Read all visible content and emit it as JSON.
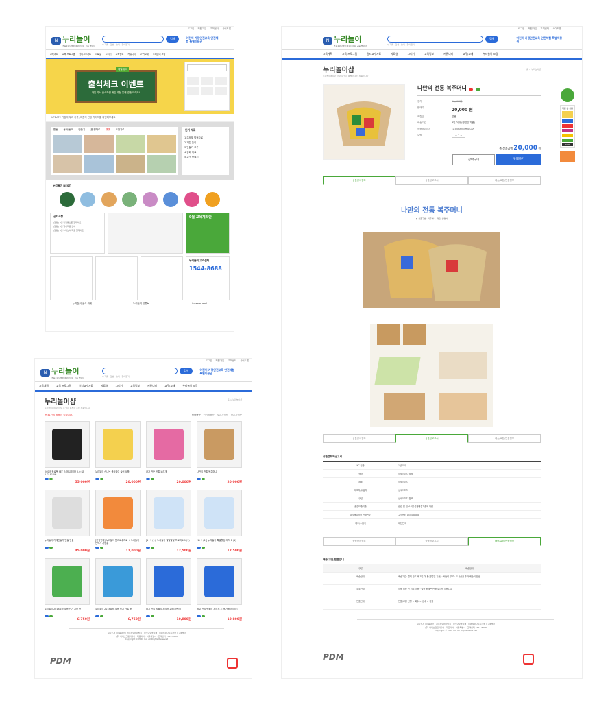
{
  "site": {
    "logo": "누리놀이",
    "logo_sub": "초등1학년부터 6학년까지 교육 놀이터",
    "search_btn": "검색",
    "keywords": "Q 가을 · 감성 · 놀이 · 종이접기",
    "promo": "어린이 가정안전교육 안전체험 특별이용권",
    "menu": [
      "교육계획",
      "교육 프로그램",
      "원리교수자료",
      "자료실",
      "그리기",
      "교육정보",
      "커뮤니티",
      "교구/교재",
      "누리놀이 코딩"
    ],
    "util": [
      "로그인",
      "회원가입",
      "고객센터",
      "사이트맵"
    ]
  },
  "home": {
    "banner_tag": "매일체크",
    "banner_title": "출석체크 이벤트",
    "banner_sub": "매일 가서 출석하면 매일 추첨 통해 경품 드려요!",
    "ticker": "UPDATE 가정의 우리 가족, 여름의 건강 가이드를 확인해보세요",
    "tabs": [
      "활동",
      "동화/동요",
      "만들기",
      "표 정자료",
      "교구",
      "추천자료"
    ],
    "rank_title": "인기 자료",
    "ranks": [
      "1 주제별 활동자료",
      "2 계절 놀이",
      "3 만들기 교구",
      "4 동화 자료",
      "5 교구 만들기"
    ],
    "best_title": "누리놀이 BEST",
    "notice_title": "공지사항",
    "notices": [
      "[알림] 9월 가정통신문 업데이트",
      "[알림] 9월 행사자료 안내",
      "[알림] 9월 누리놀이 자료 업데이트"
    ],
    "plan_title": "9월 교육계획안",
    "cs_title": "누리놀이 고객센터",
    "cs_tel": "1544-8688",
    "bottom": [
      "누리놀이 공식 카페",
      "누리놀이 유튜브",
      "i-Scream mall"
    ]
  },
  "shop": {
    "title": "누리놀이샵",
    "desc": "누리놀이에서만 만날 수 있는 특별한 추천 상품입니다",
    "crumb": "홈 > 누리놀이샵",
    "count": "총 41건의 상품이 있습니다.",
    "sorts": [
      "신상품순",
      "인기상품순",
      "낮은가격순",
      "높은가격순"
    ],
    "products": [
      {
        "name": "[MS]호응로봇 SET 스마트데이터 2.0 SE (LG19109)",
        "old": "",
        "price": "55,000원",
        "color": "#222"
      },
      {
        "name": "누리놀이 신나는 색상놀이 놀이 상품",
        "old": "",
        "price": "20,000원",
        "color": "#f4d04e"
      },
      {
        "name": "내가 만든 신통 노리개",
        "old": "",
        "price": "20,000원",
        "color": "#e56aa3"
      },
      {
        "name": "나만의 전통 복주머니",
        "old": "",
        "price": "20,000원",
        "color": "#c99a62"
      },
      {
        "name": "누리놀이 기계만들기 만들 만들",
        "old": "",
        "price": "45,000원",
        "color": "#ddd"
      },
      {
        "name": "[한정판매] 누리놀이 원리교수자료 + 누리놀이 신학기 가정통",
        "old": "",
        "price": "11,000원",
        "color": "#f28a3c"
      },
      {
        "name": "[1+1 (1)] 누리놀이 발달발달 프로젝트 1 (1)",
        "old": "",
        "price": "12,500원",
        "color": "#cfe3f7"
      },
      {
        "name": "[1+1 (1)] 누리놀이 특별활동 제작 1 (1)",
        "old": "",
        "price": "12,500원",
        "color": "#cfe3f7"
      },
      {
        "name": "누리놀이 2018요정 초등 신기 기능 북",
        "old": "",
        "price": "6,750원",
        "color": "#4caf50"
      },
      {
        "name": "누리놀이 2018요정 초등 신기 가록 북",
        "old": "",
        "price": "6,750원",
        "color": "#3a9ad9"
      },
      {
        "name": "레고 전집 빅블리 시리즈 2(비코맨이)",
        "old": "",
        "price": "10,800원",
        "color": "#2b6bd9"
      },
      {
        "name": "레고 전집 빅블리 시리즈 3 (붕가를 잡아라)",
        "old": "",
        "price": "10,800원",
        "color": "#2b6bd9"
      }
    ],
    "foot_links": "회사소개 | 이용약관 | 개인정보처리방침 | 청소년보호정책 | 이메일무단수집거부 | 고객센터",
    "foot_info": "(주) 아이스크림미디어 · 대표이사 · 서울특별시 · 고객센터 1544-8688",
    "copy": "Copyright © PDM Inc. All Rights Reserved",
    "foot_logo": "PDM"
  },
  "detail": {
    "shop_title": "누리놀이샵",
    "shop_desc": "누리놀이에서만 만날 수 있는 특별한 추천 상품입니다",
    "crumb": "홈 > 누리놀이샵",
    "name": "나만의 전통 복주머니",
    "rows": [
      {
        "k": "정가",
        "v": "50,000원"
      },
      {
        "k": "판매가",
        "v": "20,000 원"
      },
      {
        "k": "적립금",
        "v": "없음"
      },
      {
        "k": "배송기간",
        "v": "3일 이내 (영업일 기준)"
      },
      {
        "k": "상품공급업체",
        "v": "(주) 아이스크림미디어"
      },
      {
        "k": "수량",
        "v": "1"
      }
    ],
    "total_label": "총 상품금액",
    "total": "20,000",
    "total_unit": "원",
    "cart_btn": "장바구니",
    "buy_btn": "구매하기",
    "ptabs": [
      "상품상세정보",
      "상품정보고시",
      "배송/교환/반품정보"
    ],
    "detail_title": "나만의 전통 복주머니",
    "detail_sub": "▶ 상품구성 : 복주머니, 재료, 설명서",
    "info_title": "상품정보제공고시",
    "info": [
      {
        "k": "KC 인증",
        "v": "1년 이내"
      },
      {
        "k": "색상",
        "v": "상세이미지 참조"
      },
      {
        "k": "제조",
        "v": "상세이미지"
      },
      {
        "k": "제조자/수입자",
        "v": "상세이미지"
      },
      {
        "k": "구성",
        "v": "상세이미지 참조"
      },
      {
        "k": "품질보증기준",
        "v": "관련 법 및 소비자분쟁해결기준에 따름"
      },
      {
        "k": "A/S책임자와 전화번호",
        "v": "고객센터 1544-8688"
      },
      {
        "k": "제조/수입국",
        "v": "대한민국"
      }
    ],
    "ship_title": "배송/교환/반품안내",
    "ship_head": "구분",
    "ship_head2": "배송안내",
    "ship": [
      {
        "k": "배송안내",
        "v": "배송기간: 결제 완료 후 3일 이내 (영업일 기준) · 배송비 무료 · 도서산간 추가 배송비 발생"
      },
      {
        "k": "취소안내",
        "v": "상품 발송 전 취소 가능 · 발송 후에는 반품 절차를 따릅니다"
      },
      {
        "k": "반품안내",
        "v": "반품/교환 신청 > 회수 > 검수 > 환불"
      }
    ],
    "side_label": "최근 본 상품",
    "side_top": "TOP"
  }
}
